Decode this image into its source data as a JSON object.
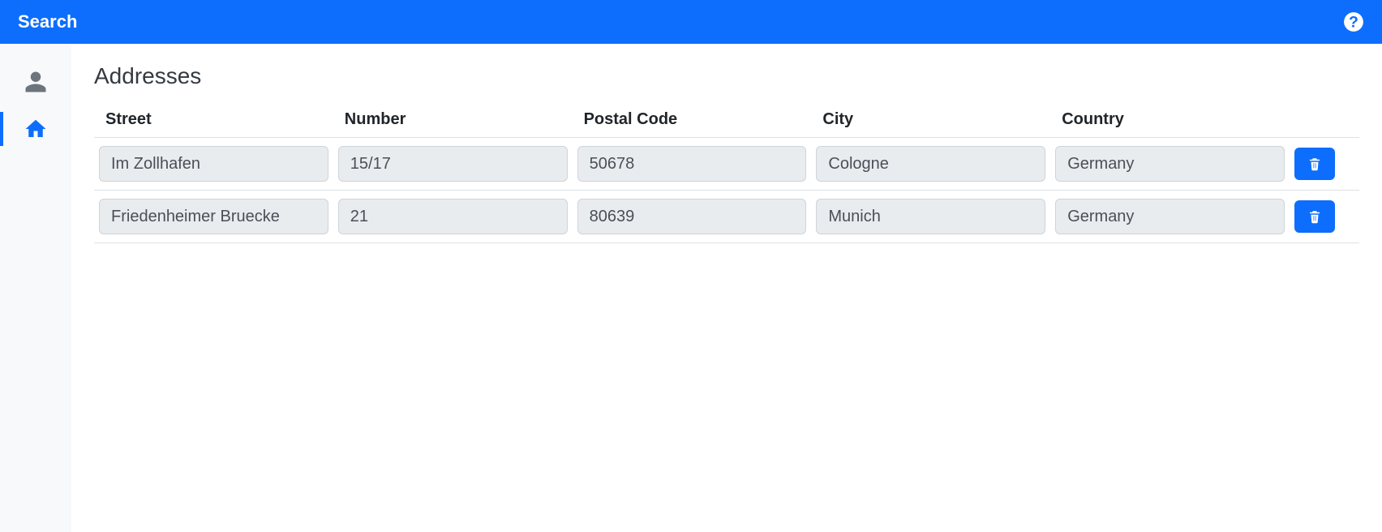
{
  "topbar": {
    "title": "Search"
  },
  "sidebar": {
    "items": [
      {
        "name": "person",
        "active": false
      },
      {
        "name": "home",
        "active": true
      }
    ]
  },
  "main": {
    "section_title": "Addresses",
    "columns": {
      "street": "Street",
      "number": "Number",
      "postal": "Postal Code",
      "city": "City",
      "country": "Country"
    },
    "rows": [
      {
        "street": "Im Zollhafen",
        "number": "15/17",
        "postal": "50678",
        "city": "Cologne",
        "country": "Germany"
      },
      {
        "street": "Friedenheimer Bruecke",
        "number": "21",
        "postal": "80639",
        "city": "Munich",
        "country": "Germany"
      }
    ]
  },
  "colors": {
    "primary": "#0d6efd",
    "muted_bg": "#e9ecef",
    "sidebar_bg": "#f8f9fa"
  }
}
